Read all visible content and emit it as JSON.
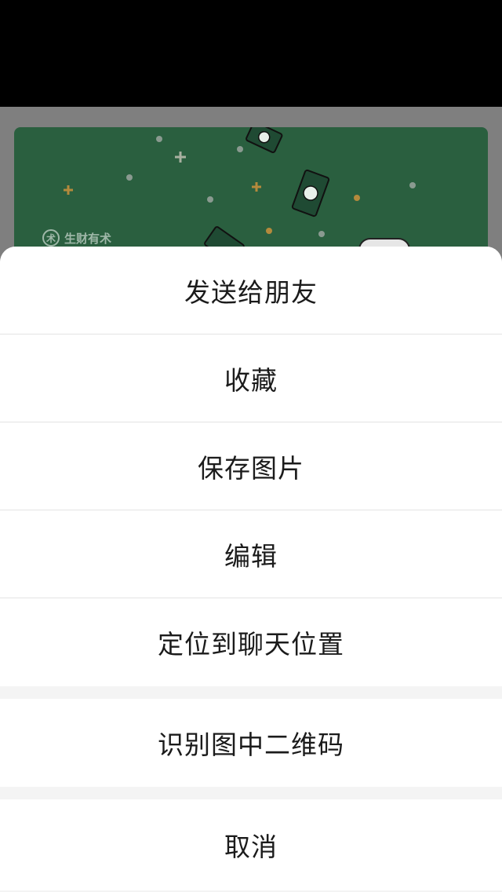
{
  "background_card": {
    "brand_text": "生财有术",
    "brand_mark": "术",
    "color": "#2a5f3f"
  },
  "action_sheet": {
    "primary_actions": [
      {
        "label": "发送给朋友"
      },
      {
        "label": "收藏"
      },
      {
        "label": "保存图片"
      },
      {
        "label": "编辑"
      },
      {
        "label": "定位到聊天位置"
      }
    ],
    "secondary_actions": [
      {
        "label": "识别图中二维码"
      }
    ],
    "cancel_label": "取消"
  }
}
